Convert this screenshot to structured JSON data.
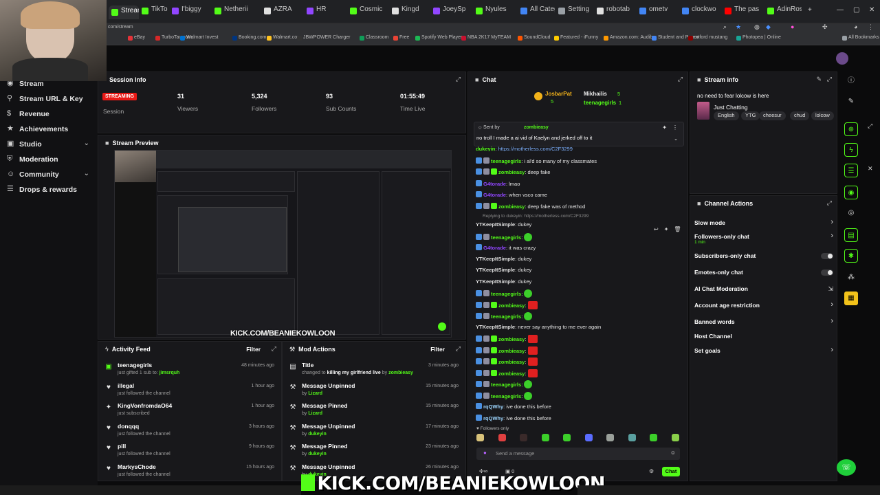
{
  "browser": {
    "tabs": [
      {
        "label": "Stream",
        "color": "#53fc18",
        "active": true
      },
      {
        "label": "TikTo",
        "color": "#53fc18"
      },
      {
        "label": "I'biggy",
        "color": "#9146ff"
      },
      {
        "label": "Netherii",
        "color": "#53fc18"
      },
      {
        "label": "AZRA",
        "color": "#e0e0e0"
      },
      {
        "label": "HR",
        "color": "#9146ff"
      },
      {
        "label": "Cosmic",
        "color": "#53fc18"
      },
      {
        "label": "Kingd",
        "color": "#e0e0e0"
      },
      {
        "label": "JoeySp",
        "color": "#9146ff"
      },
      {
        "label": "Nyules",
        "color": "#53fc18"
      },
      {
        "label": "All Catego",
        "color": "#4285f4"
      },
      {
        "label": "Setting",
        "color": "#9aa0a6"
      },
      {
        "label": "robotab",
        "color": "#e0e0e0"
      },
      {
        "label": "ometv",
        "color": "#4285f4"
      },
      {
        "label": "clockwo",
        "color": "#4285f4"
      },
      {
        "label": "The pass",
        "color": "#ff0000"
      },
      {
        "label": "AdinRos",
        "color": "#53fc18"
      }
    ],
    "address": "com/stream",
    "bookmarks": [
      {
        "label": "eBay",
        "color": "#e53238"
      },
      {
        "label": "TurboTax.com",
        "color": "#d62828"
      },
      {
        "label": "Walmart Invest",
        "color": "#0071ce"
      },
      {
        "label": "Booking.com",
        "color": "#003580"
      },
      {
        "label": "Walmart.com",
        "color": "#ffc220"
      },
      {
        "label": "JBWPOWER Charger",
        "color": "#333333"
      },
      {
        "label": "Classroom",
        "color": "#0f9d58"
      },
      {
        "label": "Free",
        "color": "#ea4335"
      },
      {
        "label": "Spotify Web Player",
        "color": "#1db954"
      },
      {
        "label": "NBA 2K17 MyTEAM",
        "color": "#c8102e"
      },
      {
        "label": "SoundCloud",
        "color": "#ff5500"
      },
      {
        "label": "Featured - iFunny",
        "color": "#ffcc00"
      },
      {
        "label": "Amazon.com: Audib",
        "color": "#ff9900"
      },
      {
        "label": "Student and Parent",
        "color": "#4285f4"
      },
      {
        "label": "oxford mustang",
        "color": "#8b0000"
      },
      {
        "label": "Photopea | Online",
        "color": "#18a497"
      },
      {
        "label": "All Bookmarks",
        "color": "#9aa0a6"
      }
    ]
  },
  "sidebar": {
    "items": [
      {
        "label": "Stream",
        "icon": "stream-icon",
        "glyph": "◉"
      },
      {
        "label": "Stream URL & Key",
        "icon": "key-icon",
        "glyph": "⚲"
      },
      {
        "label": "Revenue",
        "icon": "dollar-icon",
        "glyph": "$"
      },
      {
        "label": "Achievements",
        "icon": "trophy-icon",
        "glyph": "★"
      },
      {
        "label": "Studio",
        "icon": "studio-icon",
        "glyph": "▣",
        "expandable": true
      },
      {
        "label": "Moderation",
        "icon": "shield-icon",
        "glyph": "⛨"
      },
      {
        "label": "Community",
        "icon": "community-icon",
        "glyph": "☺",
        "expandable": true
      },
      {
        "label": "Drops & rewards",
        "icon": "gift-icon",
        "glyph": "☰"
      }
    ]
  },
  "session": {
    "title": "Session Info",
    "live_badge": "STREAMING",
    "session_label": "Session",
    "stats": [
      {
        "value": "31",
        "label": "Viewers"
      },
      {
        "value": "5,324",
        "label": "Followers"
      },
      {
        "value": "93",
        "label": "Sub Counts"
      },
      {
        "value": "01:55:49",
        "label": "Time Live"
      }
    ]
  },
  "preview": {
    "title": "Stream Preview",
    "overlay_text": "KICK.COM/BEANIEKOWLOON"
  },
  "activity": {
    "title": "Activity Feed",
    "filter": "Filter",
    "rows": [
      {
        "icon": "gift-icon",
        "glyph": "▣",
        "user": "teenagegirls",
        "action": "just gifted 1 sub to:",
        "target": "jimsrquh",
        "time": "48 minutes ago"
      },
      {
        "icon": "heart-icon",
        "glyph": "♥",
        "user": "illegal",
        "action": "just followed the channel",
        "time": "1 hour ago"
      },
      {
        "icon": "star-icon",
        "glyph": "✦",
        "user": "KingVonfromdaO64",
        "action": "just subscribed",
        "time": "1 hour ago"
      },
      {
        "icon": "heart-icon",
        "glyph": "♥",
        "user": "donqqq",
        "action": "just followed the channel",
        "time": "3 hours ago"
      },
      {
        "icon": "heart-icon",
        "glyph": "♥",
        "user": "pill",
        "action": "just followed the channel",
        "time": "9 hours ago"
      },
      {
        "icon": "heart-icon",
        "glyph": "♥",
        "user": "MarkysChode",
        "action": "just followed the channel",
        "time": "15 hours ago"
      }
    ]
  },
  "mod_actions": {
    "title": "Mod Actions",
    "filter": "Filter",
    "rows": [
      {
        "icon": "title-icon",
        "glyph": "▤",
        "action": "Title",
        "detail": "changed to",
        "value": "killing my girlfriend live",
        "by_word": "by",
        "by": "zombieasy",
        "time": "3 minutes ago"
      },
      {
        "icon": "hammer-icon",
        "glyph": "⚒",
        "action": "Message Unpinned",
        "by_word": "by",
        "by": "Lizard",
        "time": "15 minutes ago"
      },
      {
        "icon": "hammer-icon",
        "glyph": "⚒",
        "action": "Message Pinned",
        "by_word": "by",
        "by": "Lizard",
        "time": "15 minutes ago"
      },
      {
        "icon": "hammer-icon",
        "glyph": "⚒",
        "action": "Message Unpinned",
        "by_word": "by",
        "by": "dukeyin",
        "time": "17 minutes ago"
      },
      {
        "icon": "hammer-icon",
        "glyph": "⚒",
        "action": "Message Pinned",
        "by_word": "by",
        "by": "dukeyin",
        "time": "23 minutes ago"
      },
      {
        "icon": "hammer-icon",
        "glyph": "⚒",
        "action": "Message Unpinned",
        "by_word": "by",
        "by": "dukeyin",
        "time": "26 minutes ago"
      }
    ]
  },
  "chat": {
    "title": "Chat",
    "leaderboard": [
      {
        "user": "JosbarPat",
        "count": "5"
      },
      {
        "user": "Mikhailis",
        "count": "5"
      },
      {
        "user": "teenagegirls",
        "count": "1"
      }
    ],
    "pinned": {
      "sent_by": "Sent by",
      "user": "zombieasy",
      "message": "no troll I made a ai vid of Kaelyn and jerked off to it"
    },
    "messages": [
      {
        "user": "dukeyin",
        "text": "https://motherless.com/C2F3299",
        "color": "#53fc18",
        "partial": true
      },
      {
        "user": "teenagegirls",
        "text": "i al'd so many of my classmates",
        "color": "#53fc18",
        "badges": 2
      },
      {
        "user": "zombieasy",
        "text": "deep fake",
        "color": "#53fc18",
        "badges": 3
      },
      {
        "user": "G4torade",
        "text": "lmao",
        "color": "#9146ff",
        "badges": 1
      },
      {
        "user": "G4torade",
        "text": "when vsco came",
        "color": "#9146ff",
        "badges": 1
      },
      {
        "user": "zombieasy",
        "text": "deep fake was of method",
        "color": "#53fc18",
        "badges": 3
      },
      {
        "user": "YTKeepItSimple",
        "text": "dukey",
        "color": "#e0e0e0",
        "reply": "Replying to dukeyin: https://motherless.com/C2F3299"
      },
      {
        "user": "teenagegirls",
        "text": "",
        "color": "#53fc18",
        "badges": 2,
        "emote": "green"
      },
      {
        "user": "G4torade",
        "text": "it was crazy",
        "color": "#9146ff",
        "badges": 1
      },
      {
        "user": "YTKeepItSimple",
        "text": "dukey",
        "color": "#e0e0e0"
      },
      {
        "user": "YTKeepItSimple",
        "text": "dukey",
        "color": "#e0e0e0"
      },
      {
        "user": "YTKeepItSimple",
        "text": "dukey",
        "color": "#e0e0e0"
      },
      {
        "user": "teenagegirls",
        "text": "",
        "color": "#53fc18",
        "badges": 2,
        "emote": "green"
      },
      {
        "user": "zombieasy",
        "text": "",
        "color": "#53fc18",
        "badges": 3,
        "emote": "red"
      },
      {
        "user": "teenagegirls",
        "text": "",
        "color": "#53fc18",
        "badges": 2,
        "emote": "green"
      },
      {
        "user": "YTKeepItSimple",
        "text": "never say anything to me ever again",
        "color": "#e0e0e0"
      },
      {
        "user": "zombieasy",
        "text": "",
        "color": "#53fc18",
        "badges": 3,
        "emote": "red"
      },
      {
        "user": "zombieasy",
        "text": "",
        "color": "#53fc18",
        "badges": 3,
        "emote": "red"
      },
      {
        "user": "zombieasy",
        "text": "",
        "color": "#53fc18",
        "badges": 3,
        "emote": "red"
      },
      {
        "user": "zombieasy",
        "text": "",
        "color": "#53fc18",
        "badges": 3,
        "emote": "red"
      },
      {
        "user": "teenagegirls",
        "text": "",
        "color": "#53fc18",
        "badges": 2,
        "emote": "green"
      },
      {
        "user": "teenagegirls",
        "text": "",
        "color": "#53fc18",
        "badges": 2,
        "emote": "green"
      },
      {
        "user": "rqQWhy",
        "text": "ive done this before",
        "color": "#9dd6ff",
        "badges": 1
      },
      {
        "user": "rqQWhy",
        "text": "ive done this before",
        "color": "#9dd6ff",
        "badges": 1
      }
    ],
    "followers_only": "Followers only",
    "input_placeholder": "Send a message",
    "points": "0",
    "chat_button": "Chat"
  },
  "stream_info": {
    "title": "Stream info",
    "stream_title": "no need to fear lolcow is here",
    "category": "Just Chatting",
    "tags": [
      "English",
      "YTG",
      "cheesur",
      "chud",
      "lolcow"
    ]
  },
  "channel_actions": {
    "title": "Channel Actions",
    "rows": [
      {
        "label": "Slow mode",
        "control": "arrow"
      },
      {
        "label": "Followers-only chat",
        "sub": "1 min",
        "control": "arrow"
      },
      {
        "label": "Subscribers-only chat",
        "control": "toggle"
      },
      {
        "label": "Emotes-only chat",
        "control": "toggle"
      },
      {
        "label": "AI Chat Moderation",
        "control": "external"
      },
      {
        "label": "Account age restriction",
        "control": "arrow"
      },
      {
        "label": "Banned words",
        "control": "arrow"
      },
      {
        "label": "Host Channel",
        "control": "none"
      },
      {
        "label": "Set goals",
        "control": "arrow"
      }
    ]
  },
  "overlay": {
    "banner_text": "KICK.COM/BEANIEKOWLOON"
  },
  "colors": {
    "accent": "#53fc18",
    "live": "#e91916",
    "panel": "#18181b",
    "background": "#0b0b0c"
  }
}
